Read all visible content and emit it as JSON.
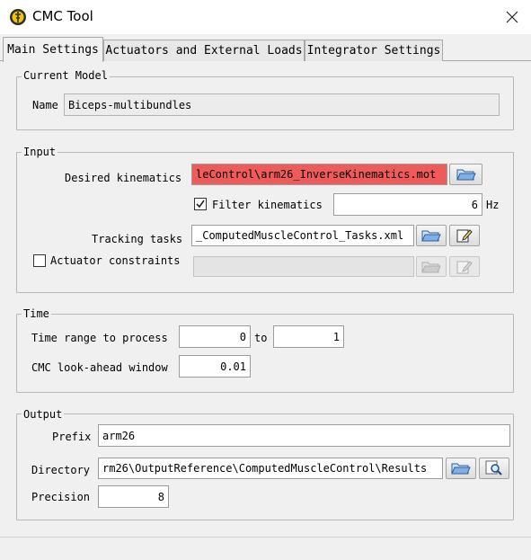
{
  "window": {
    "title": "CMC Tool",
    "close_icon": "close-icon",
    "app_icon": "cmc-tool-icon"
  },
  "tabs": [
    {
      "label": "Main Settings",
      "active": true
    },
    {
      "label": "Actuators and External Loads",
      "active": false
    },
    {
      "label": "Integrator Settings",
      "active": false
    }
  ],
  "current_model": {
    "legend": "Current Model",
    "name_label": "Name",
    "name_value": "Biceps-multibundles"
  },
  "input": {
    "legend": "Input",
    "desired_kinematics_label": "Desired kinematics",
    "desired_kinematics_value": "leControl\\arm26_InverseKinematics.mot",
    "desired_kinematics_error_color": "#ef5b5b",
    "filter_kinematics_label": "Filter kinematics",
    "filter_kinematics_checked": true,
    "filter_value": "6",
    "filter_unit": "Hz",
    "tracking_tasks_label": "Tracking tasks",
    "tracking_tasks_value": "_ComputedMuscleControl_Tasks.xml",
    "actuator_constraints_label": "Actuator constraints",
    "actuator_constraints_checked": false,
    "actuator_constraints_value": ""
  },
  "time": {
    "legend": "Time",
    "time_range_label": "Time range to process",
    "time_start": "0",
    "to_label": "to",
    "time_end": "1",
    "lookahead_label": "CMC look-ahead window",
    "lookahead_value": "0.01"
  },
  "output": {
    "legend": "Output",
    "prefix_label": "Prefix",
    "prefix_value": "arm26",
    "directory_label": "Directory",
    "directory_value": "rm26\\OutputReference\\ComputedMuscleControl\\Results",
    "precision_label": "Precision",
    "precision_value": "8"
  }
}
